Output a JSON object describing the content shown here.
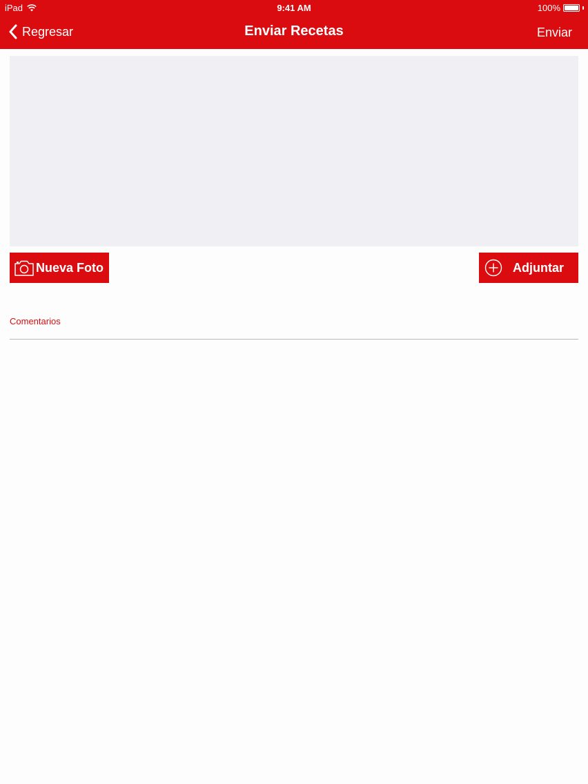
{
  "status_bar": {
    "carrier": "iPad",
    "time": "9:41 AM",
    "battery": "100%"
  },
  "nav": {
    "back_label": "Regresar",
    "title": "Enviar Recetas",
    "send_label": "Enviar"
  },
  "photo_area": {
    "background": "#efeff4"
  },
  "buttons": {
    "new_photo": "Nueva Foto",
    "attach": "Adjuntar"
  },
  "comments": {
    "label": "Comentarios",
    "value": ""
  },
  "colors": {
    "accent": "#da0c10"
  },
  "icons": [
    "wifi-icon",
    "battery-icon",
    "chevron-left-icon",
    "camera-icon",
    "plus-circle-icon"
  ]
}
